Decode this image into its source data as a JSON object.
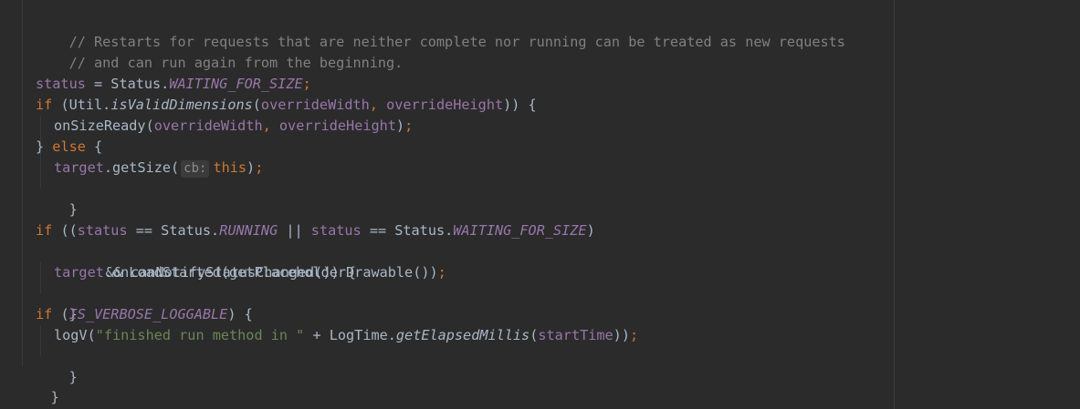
{
  "editor": {
    "lines": {
      "l1": {
        "comment": "// Restarts for requests that are neither complete nor running can be treated as new requests"
      },
      "l2": {
        "comment": "// and can run again from the beginning."
      },
      "l4": {
        "status": "status",
        "eq": " = Status.",
        "waiting": "WAITING_FOR_SIZE",
        "semi": ";"
      },
      "l5": {
        "if": "if",
        "open": " (Util.",
        "method": "isValidDimensions",
        "paren": "(",
        "width": "overrideWidth",
        "comma": ", ",
        "height": "overrideHeight",
        "close": ")) {"
      },
      "l6": {
        "call": "onSizeReady(",
        "width": "overrideWidth",
        "comma": ", ",
        "height": "overrideHeight",
        "close": ")",
        "semi": ";"
      },
      "l7": {
        "brace": "} ",
        "else": "else",
        "open": " {"
      },
      "l8": {
        "target": "target",
        "call": ".getSize(",
        "hint": "cb:",
        "this": "this",
        "close": ")",
        "semi": ";"
      },
      "l9": {
        "brace": "}"
      },
      "l11": {
        "if": "if",
        "open": " ((",
        "status1": "status",
        "eq1": " == Status.",
        "running": "RUNNING",
        "or": " || ",
        "status2": "status",
        "eq2": " == Status.",
        "waiting": "WAITING_FOR_SIZE",
        "close": ")"
      },
      "l12": {
        "text": "&& canNotifyStatusChanged()) {"
      },
      "l13": {
        "target": "target",
        "call": ".onLoadStarted(getPlaceholderDrawable())",
        "semi": ";"
      },
      "l14": {
        "brace": "}"
      },
      "l15": {
        "if": "if",
        "open": " (",
        "verbose": "IS_VERBOSE_LOGGABLE",
        "close": ") {"
      },
      "l16": {
        "call": "logV(",
        "string": "\"finished run method in \"",
        "plus": " + LogTime.",
        "method": "getElapsedMillis",
        "paren": "(",
        "start": "startTime",
        "close": "))",
        "semi": ";"
      },
      "l17": {
        "brace": "}"
      },
      "l18": {
        "brace": "}"
      },
      "l19": {
        "brace": "}"
      }
    }
  }
}
